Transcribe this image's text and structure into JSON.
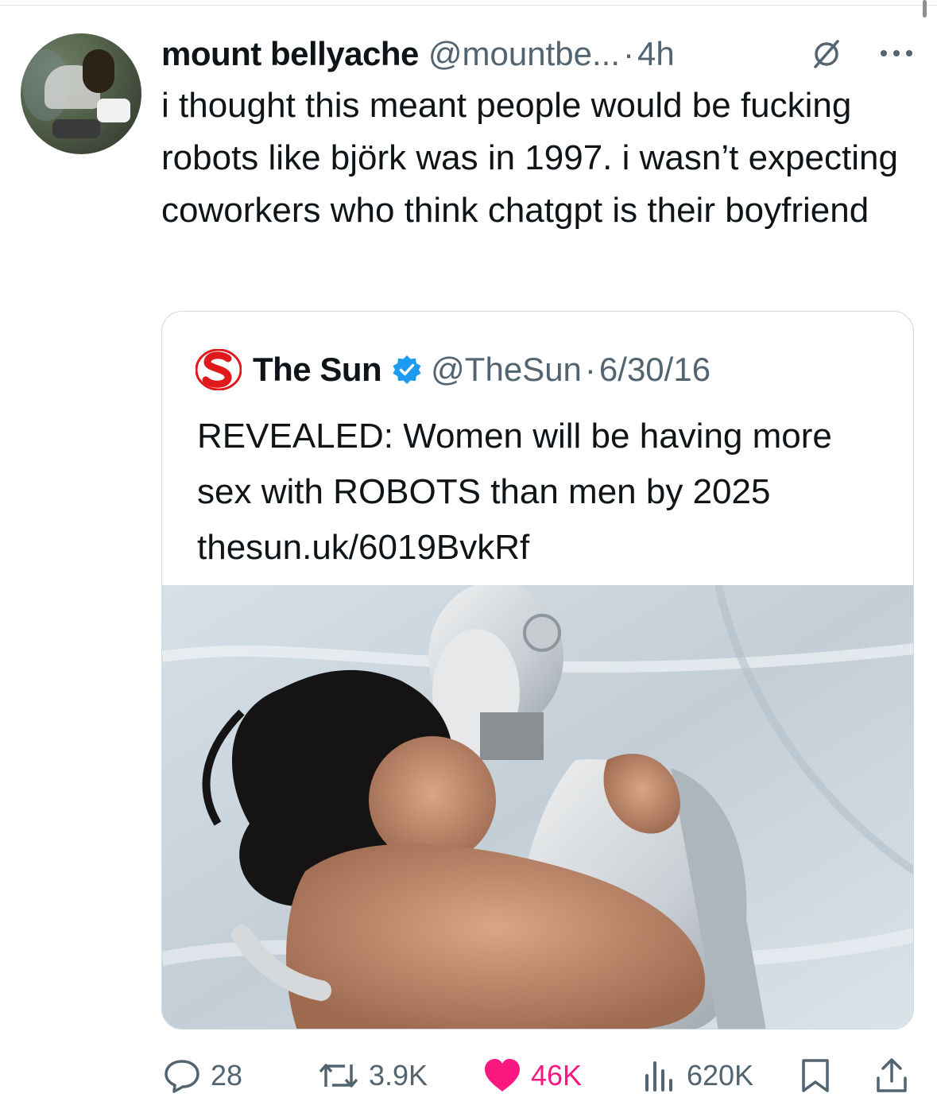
{
  "tweet": {
    "author_name": "mount bellyache",
    "author_handle": "@mountbe...",
    "separator": "·",
    "time": "4h",
    "text": "i thought this meant people would be fucking robots like björk was in 1997. i wasn’t expecting coworkers who think chatgpt is their boyfriend",
    "icons": {
      "status": "slash-circle-icon",
      "more": "more-options-icon"
    }
  },
  "quoted_tweet": {
    "author_name": "The Sun",
    "author_handle": "@TheSun",
    "separator": "·",
    "date": "6/30/16",
    "text": "REVEALED: Women will be having more sex with ROBOTS than men by 2025 thesun.uk/6019BvkRf",
    "icons": {
      "logo": "the-sun-logo",
      "badge": "verified-badge-icon"
    },
    "colors": {
      "logo_red": "#e0191d",
      "verified": "#1d9bf0"
    }
  },
  "actions": {
    "replies": "28",
    "reposts": "3.9K",
    "likes": "46K",
    "views": "620K",
    "icons": [
      "reply-icon",
      "repost-icon",
      "like-icon",
      "views-icon",
      "bookmark-icon",
      "share-icon"
    ],
    "colors": {
      "muted": "#536471",
      "like": "#f91880"
    }
  }
}
